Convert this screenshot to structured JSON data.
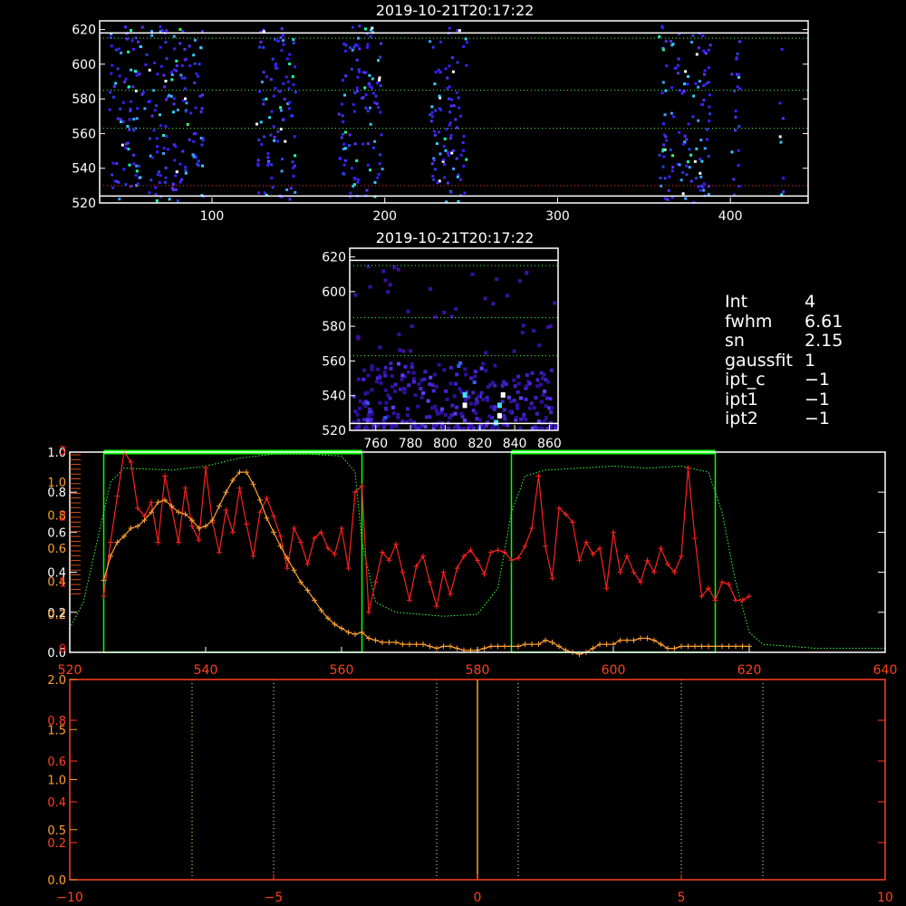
{
  "panels": {
    "top_title": "2019-10-21T20:17:22",
    "mid_title": "2019-10-21T20:17:22"
  },
  "info": [
    {
      "key": "Int",
      "value": "4"
    },
    {
      "key": "fwhm",
      "value": "6.61"
    },
    {
      "key": "sn",
      "value": "2.15"
    },
    {
      "key": "gaussfit",
      "value": "1"
    },
    {
      "key": "ipt_c",
      "value": "−1"
    },
    {
      "key": "ipt1",
      "value": "−1"
    },
    {
      "key": "ipt2",
      "value": "−1"
    }
  ],
  "colors": {
    "background": "#000000",
    "axes": "#ffffff",
    "red_series": "#ff2020",
    "orange_series": "#ffa030",
    "green_profile": "#40ff40",
    "window_box": "#00ff00",
    "lower_axes": "#ff4020"
  },
  "chart_data": [
    {
      "type": "heatmap",
      "title": "2019-10-21T20:17:22",
      "xlim": [
        35,
        445
      ],
      "ylim": [
        520,
        625
      ],
      "x_ticks": [
        100,
        200,
        300,
        400
      ],
      "y_ticks": [
        520,
        540,
        560,
        580,
        600,
        620
      ],
      "grid": "dotted green horizontal lines at 563, 585, 615; red dotted at 530",
      "column_bands": [
        [
          40,
          95
        ],
        [
          125,
          148
        ],
        [
          172,
          198
        ],
        [
          225,
          247
        ],
        [
          358,
          388
        ],
        [
          400,
          405
        ],
        [
          428,
          430
        ]
      ]
    },
    {
      "type": "heatmap",
      "title": "2019-10-21T20:17:22",
      "xlim": [
        745,
        865
      ],
      "ylim": [
        520,
        625
      ],
      "x_ticks": [
        760,
        780,
        800,
        820,
        840,
        860
      ],
      "y_ticks": [
        520,
        540,
        560,
        580,
        600,
        620
      ]
    },
    {
      "type": "line",
      "xlim": [
        520,
        640
      ],
      "ylim": [
        0,
        1.0
      ],
      "x_ticks": [
        520,
        540,
        560,
        580,
        600,
        620,
        640
      ],
      "left_ticks_white": [
        "0.0",
        "0.2",
        "0.4",
        "0.6",
        "0.8",
        "1.0"
      ],
      "left_ticks_orange": [
        "0.2",
        "0.4",
        "0.6",
        "0.8",
        "1.0"
      ],
      "left_ticks_red": [
        "0",
        "1",
        "2",
        "3"
      ],
      "windows": [
        [
          525,
          563
        ],
        [
          585,
          615
        ]
      ],
      "series": [
        {
          "color": "red",
          "x": [
            525,
            526,
            527,
            528,
            529,
            530,
            531,
            532,
            533,
            534,
            535,
            536,
            537,
            538,
            539,
            540,
            541,
            542,
            543,
            544,
            545,
            546,
            547,
            548,
            549,
            550,
            551,
            552,
            553,
            554,
            555,
            556,
            557,
            558,
            559,
            560,
            561,
            562,
            563,
            564,
            565,
            566,
            567,
            568,
            569,
            570,
            571,
            572,
            573,
            574,
            575,
            576,
            577,
            578,
            579,
            580,
            581,
            582,
            583,
            584,
            585,
            586,
            587,
            588,
            589,
            590,
            591,
            592,
            593,
            594,
            595,
            596,
            597,
            598,
            599,
            600,
            601,
            602,
            603,
            604,
            605,
            606,
            607,
            608,
            609,
            610,
            611,
            612,
            613,
            614,
            615,
            616,
            617,
            618,
            619,
            620
          ],
          "values": [
            0.28,
            0.55,
            0.78,
            1.0,
            0.95,
            0.72,
            0.68,
            0.75,
            0.55,
            0.88,
            0.72,
            0.55,
            0.82,
            0.63,
            0.56,
            0.92,
            0.65,
            0.5,
            0.71,
            0.6,
            0.82,
            0.64,
            0.48,
            0.7,
            0.77,
            0.68,
            0.58,
            0.42,
            0.62,
            0.55,
            0.44,
            0.57,
            0.6,
            0.52,
            0.49,
            0.62,
            0.42,
            0.8,
            0.83,
            0.2,
            0.35,
            0.5,
            0.46,
            0.54,
            0.4,
            0.26,
            0.43,
            0.48,
            0.35,
            0.23,
            0.4,
            0.29,
            0.42,
            0.48,
            0.51,
            0.46,
            0.39,
            0.5,
            0.51,
            0.5,
            0.46,
            0.47,
            0.53,
            0.62,
            0.88,
            0.53,
            0.37,
            0.72,
            0.69,
            0.65,
            0.46,
            0.55,
            0.49,
            0.52,
            0.32,
            0.6,
            0.4,
            0.48,
            0.4,
            0.35,
            0.46,
            0.4,
            0.52,
            0.44,
            0.4,
            0.48,
            0.92,
            0.57,
            0.28,
            0.32,
            0.26,
            0.35,
            0.34,
            0.26,
            0.26,
            0.28
          ]
        },
        {
          "color": "orange",
          "x": [
            525,
            526,
            527,
            528,
            529,
            530,
            531,
            532,
            533,
            534,
            535,
            536,
            537,
            538,
            539,
            540,
            541,
            542,
            543,
            544,
            545,
            546,
            547,
            548,
            549,
            550,
            551,
            552,
            553,
            554,
            555,
            556,
            557,
            558,
            559,
            560,
            561,
            562,
            563,
            564,
            565,
            566,
            567,
            568,
            569,
            570,
            571,
            572,
            573,
            574,
            575,
            576,
            577,
            578,
            579,
            580,
            581,
            582,
            583,
            584,
            585,
            586,
            587,
            588,
            589,
            590,
            591,
            592,
            593,
            594,
            595,
            596,
            597,
            598,
            599,
            600,
            601,
            602,
            603,
            604,
            605,
            606,
            607,
            608,
            609,
            610,
            611,
            612,
            613,
            614,
            615,
            616,
            617,
            618,
            619,
            620
          ],
          "values": [
            0.36,
            0.48,
            0.55,
            0.58,
            0.62,
            0.63,
            0.66,
            0.7,
            0.75,
            0.76,
            0.73,
            0.7,
            0.69,
            0.66,
            0.62,
            0.63,
            0.66,
            0.73,
            0.8,
            0.86,
            0.9,
            0.9,
            0.84,
            0.76,
            0.67,
            0.6,
            0.53,
            0.47,
            0.41,
            0.35,
            0.31,
            0.26,
            0.21,
            0.17,
            0.14,
            0.12,
            0.1,
            0.09,
            0.1,
            0.07,
            0.06,
            0.05,
            0.05,
            0.05,
            0.04,
            0.04,
            0.04,
            0.04,
            0.03,
            0.02,
            0.03,
            0.03,
            0.02,
            0.01,
            0.01,
            0.01,
            0.02,
            0.03,
            0.03,
            0.03,
            0.03,
            0.03,
            0.04,
            0.04,
            0.04,
            0.06,
            0.05,
            0.03,
            0.01,
            0.0,
            -0.01,
            0.0,
            0.02,
            0.04,
            0.04,
            0.04,
            0.06,
            0.06,
            0.06,
            0.07,
            0.07,
            0.06,
            0.04,
            0.02,
            0.02,
            0.03,
            0.03,
            0.03,
            0.03,
            0.03,
            0.03,
            0.03,
            0.03,
            0.03,
            0.03,
            0.03
          ]
        }
      ]
    },
    {
      "type": "line",
      "xlim": [
        -10,
        10
      ],
      "x_ticks": [
        -10,
        -5,
        0,
        5,
        10
      ],
      "left_ticks_orange": [
        "0.0",
        "0.5",
        "1.0",
        "1.5",
        "2.0"
      ],
      "left_ticks_red": [
        "0.2",
        "0.4",
        "0.6",
        "0.8"
      ],
      "vlines_dotted": [
        -7,
        -5,
        -1,
        1,
        5,
        7
      ],
      "vline_solid": 0
    }
  ]
}
